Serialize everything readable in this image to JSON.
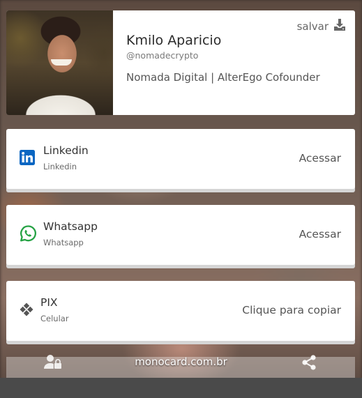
{
  "profile": {
    "name": "Kmilo Aparicio",
    "handle": "@nomadecrypto",
    "bio": "Nomada Digital | AlterEgo Cofounder",
    "save_label": "salvar"
  },
  "links": [
    {
      "title": "Linkedin",
      "subtitle": "Linkedin",
      "action": "Acessar",
      "icon": "linkedin-icon",
      "color": "#0a66c2"
    },
    {
      "title": "Whatsapp",
      "subtitle": "Whatsapp",
      "action": "Acessar",
      "icon": "whatsapp-icon",
      "color": "#25a244"
    },
    {
      "title": "PIX",
      "subtitle": "Celular",
      "action": "Clique para copiar",
      "icon": "pix-icon",
      "color": "#555555"
    }
  ],
  "footer": {
    "brand": "monocard.com.br",
    "left_icon": "contact-lock-icon",
    "right_icon": "share-icon"
  }
}
